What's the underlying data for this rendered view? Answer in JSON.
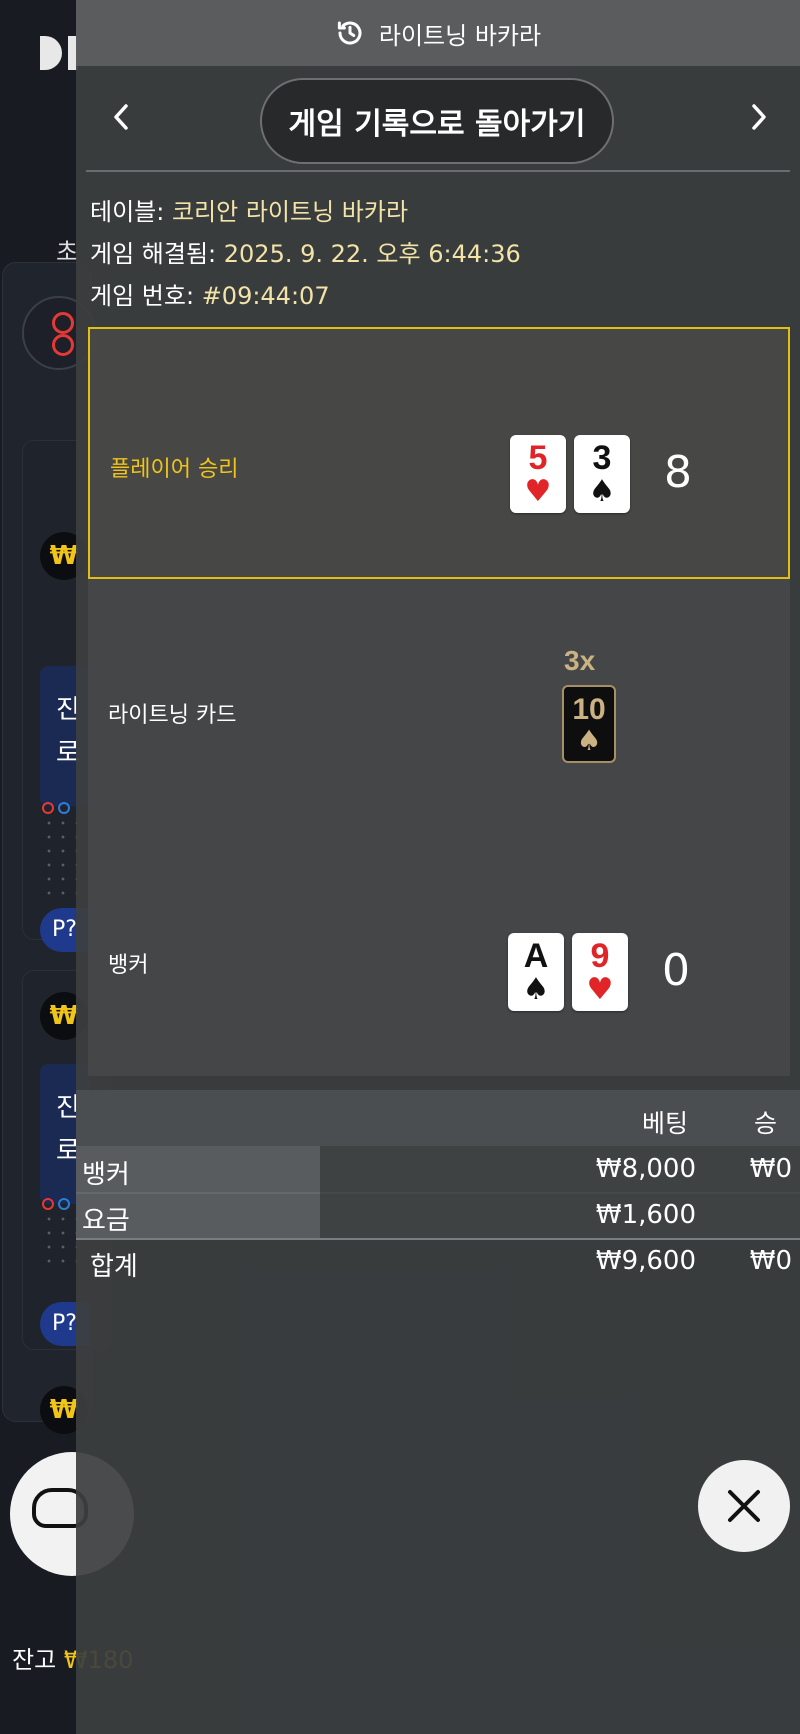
{
  "header": {
    "title": "라이트닝 바카라",
    "icon": "history-icon"
  },
  "nav": {
    "back_label": "게임 기록으로 돌아가기",
    "prev_icon": "chevron-left-icon",
    "next_icon": "chevron-right-icon"
  },
  "info": {
    "table_label": "테이블:",
    "table_value": "코리안 라이트닝 바카라",
    "resolved_label": "게임 해결됨:",
    "resolved_value": "2025. 9. 22. 오후 6:44:36",
    "number_label": "게임 번호:",
    "number_value": "#09:44:07"
  },
  "player": {
    "label": "플레이어 승리",
    "label_color": "#f0c419",
    "cards": [
      {
        "rank": "5",
        "suit": "♥",
        "color": "red"
      },
      {
        "rank": "3",
        "suit": "♠",
        "color": "black"
      }
    ],
    "score": "8"
  },
  "lightning": {
    "label": "라이트닝 카드",
    "multiplier": "3x",
    "card": {
      "rank": "10",
      "suit": "♠"
    }
  },
  "banker": {
    "label": "뱅커",
    "cards": [
      {
        "rank": "A",
        "suit": "♠",
        "color": "black"
      },
      {
        "rank": "9",
        "suit": "♥",
        "color": "red"
      }
    ],
    "score": "0"
  },
  "bets": {
    "col_bet": "베팅",
    "col_win": "승",
    "rows": [
      {
        "name": "뱅커",
        "bet": "₩8,000",
        "win": "₩0"
      },
      {
        "name": "요금",
        "bet": "₩1,600",
        "win": ""
      }
    ],
    "total": {
      "name": "합계",
      "bet": "₩9,600",
      "win": "₩0"
    }
  },
  "close_icon": "close-icon",
  "background": {
    "tab_fragment": "초",
    "chip_symbol": "₩",
    "blue_text_1": "진",
    "blue_text_2": "로",
    "p_badge": "P?",
    "balance_label": "잔고",
    "balance_value": "₩180"
  },
  "colors": {
    "accent": "#f0c419",
    "panel": "#3c3e40",
    "highlight_border": "#e3bf13"
  }
}
